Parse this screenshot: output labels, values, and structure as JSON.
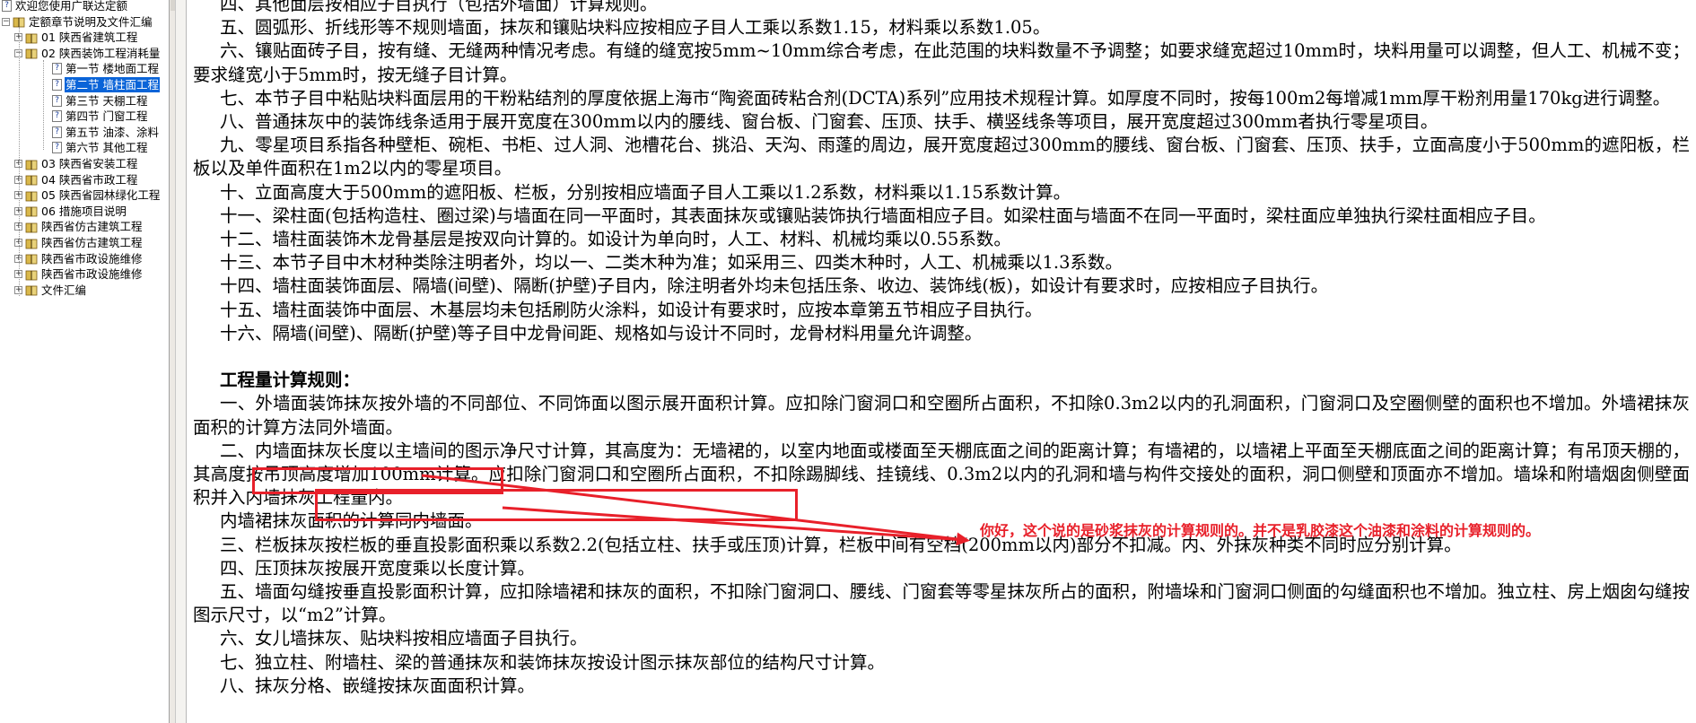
{
  "tree": {
    "items": [
      {
        "label": "欢迎您使用广联达定额",
        "icon": "page-icon",
        "level": 0,
        "expander": "none"
      },
      {
        "label": "定额章节说明及文件汇编",
        "icon": "book-icon",
        "level": 0,
        "expander": "minus"
      },
      {
        "label": "01 陕西省建筑工程",
        "icon": "book-icon",
        "level": 1,
        "expander": "plus"
      },
      {
        "label": "02 陕西装饰工程消耗量",
        "icon": "book-icon",
        "level": 1,
        "expander": "minus"
      },
      {
        "label": "第一节 楼地面工程",
        "icon": "page-icon",
        "level": 2,
        "expander": "none"
      },
      {
        "label": "第二节 墙柱面工程",
        "icon": "page-icon",
        "level": 2,
        "expander": "none",
        "selected": true
      },
      {
        "label": "第三节 天棚工程",
        "icon": "page-icon",
        "level": 2,
        "expander": "none"
      },
      {
        "label": "第四节 门窗工程",
        "icon": "page-icon",
        "level": 2,
        "expander": "none"
      },
      {
        "label": "第五节 油漆、涂料",
        "icon": "page-icon",
        "level": 2,
        "expander": "none"
      },
      {
        "label": "第六节 其他工程",
        "icon": "page-icon",
        "level": 2,
        "expander": "none"
      },
      {
        "label": "03 陕西省安装工程",
        "icon": "book-icon",
        "level": 1,
        "expander": "plus"
      },
      {
        "label": "04 陕西省市政工程",
        "icon": "book-icon",
        "level": 1,
        "expander": "plus"
      },
      {
        "label": "05 陕西省园林绿化工程",
        "icon": "book-icon",
        "level": 1,
        "expander": "plus"
      },
      {
        "label": "06 措施项目说明",
        "icon": "book-icon",
        "level": 1,
        "expander": "plus"
      },
      {
        "label": "陕西省仿古建筑工程",
        "icon": "book-icon",
        "level": 1,
        "expander": "plus"
      },
      {
        "label": "陕西省仿古建筑工程",
        "icon": "book-icon",
        "level": 1,
        "expander": "plus"
      },
      {
        "label": "陕西省市政设施维修",
        "icon": "book-icon",
        "level": 1,
        "expander": "plus"
      },
      {
        "label": "陕西省市政设施维修",
        "icon": "book-icon",
        "level": 1,
        "expander": "plus"
      },
      {
        "label": "文件汇编",
        "icon": "book-icon",
        "level": 1,
        "expander": "plus"
      }
    ]
  },
  "content": [
    {
      "type": "para",
      "text": "四、其他面层按相应子目执行（包括外墙面）计算规则。"
    },
    {
      "type": "para",
      "text": "五、圆弧形、折线形等不规则墙面，抹灰和镶贴块料应按相应子目人工乘以系数1.15，材料乘以系数1.05。"
    },
    {
      "type": "para",
      "text": "六、镶贴面砖子目，按有缝、无缝两种情况考虑。有缝的缝宽按5mm~10mm综合考虑，在此范围的块料数量不予调整；如要求缝宽超过10mm时，块料用量可以调整，但人工、机械不变；要求缝宽小于5mm时，按无缝子目计算。"
    },
    {
      "type": "para",
      "text": "七、本节子目中粘贴块料面层用的干粉粘结剂的厚度依据上海市“陶瓷面砖粘合剂(DCTA)系列”应用技术规程计算。如厚度不同时，按每100m2每增减1mm厚干粉剂用量170kg进行调整。"
    },
    {
      "type": "para",
      "text": "八、普通抹灰中的装饰线条适用于展开宽度在300mm以内的腰线、窗台板、门窗套、压顶、扶手、横竖线条等项目，展开宽度超过300mm者执行零星项目。"
    },
    {
      "type": "para",
      "text": "九、零星项目系指各种壁柜、碗柜、书柜、过人洞、池槽花台、挑沿、天沟、雨蓬的周边，展开宽度超过300mm的腰线、窗台板、门窗套、压顶、扶手，立面高度小于500mm的遮阳板，栏板以及单件面积在1m2以内的零星项目。"
    },
    {
      "type": "para",
      "text": "十、立面高度大于500mm的遮阳板、栏板，分别按相应墙面子目人工乘以1.2系数，材料乘以1.15系数计算。"
    },
    {
      "type": "para",
      "text": "十一、梁柱面(包括构造柱、圈过梁)与墙面在同一平面时，其表面抹灰或镶贴装饰执行墙面相应子目。如梁柱面与墙面不在同一平面时，梁柱面应单独执行梁柱面相应子目。"
    },
    {
      "type": "para",
      "text": "十二、墙柱面装饰木龙骨基层是按双向计算的。如设计为单向时，人工、材料、机械均乘以0.55系数。"
    },
    {
      "type": "para",
      "text": "十三、本节子目中木材种类除注明者外，均以一、二类木种为准；如采用三、四类木种时，人工、机械乘以1.3系数。"
    },
    {
      "type": "para",
      "text": "十四、墙柱面装饰面层、隔墙(间壁)、隔断(护壁)子目内，除注明者外均未包括压条、收边、装饰线(板)，如设计有要求时，应按相应子目执行。"
    },
    {
      "type": "para",
      "text": "十五、墙柱面装饰中面层、木基层均未包括刷防火涂料，如设计有要求时，应按本章第五节相应子目执行。"
    },
    {
      "type": "para",
      "text": "十六、隔墙(间壁)、隔断(护壁)等子目中龙骨间距、规格如与设计不同时，龙骨材料用量允许调整。"
    },
    {
      "type": "blank",
      "text": ""
    },
    {
      "type": "heading",
      "text": "工程量计算规则："
    },
    {
      "type": "para",
      "text": "一、外墙面装饰抹灰按外墙的不同部位、不同饰面以图示展开面积计算。应扣除门窗洞口和空圈所占面积，不扣除0.3m2以内的孔洞面积，门窗洞口及空圈侧壁的面积也不增加。外墙裙抹灰面积的计算方法同外墙面。"
    },
    {
      "type": "para",
      "text": "二、内墙面抹灰长度以主墙间的图示净尺寸计算，其高度为：无墙裙的，以室内地面或楼面至天棚底面之间的距离计算；有墙裙的，以墙裙上平面至天棚底面之间的距离计算；有吊顶天棚的，其高度按吊顶高度增加100mm计算。应扣除门窗洞口和空圈所占面积，不扣除踢脚线、挂镜线、0.3m2以内的孔洞和墙与构件交接处的面积，洞口侧壁和顶面亦不增加。墙垛和附墙烟囱侧壁面积并入内墙抹灰工程量内。"
    },
    {
      "type": "para",
      "text": "内墙裙抹灰面积的计算同内墙面。"
    },
    {
      "type": "para",
      "text": "三、栏板抹灰按栏板的垂直投影面积乘以系数2.2(包括立柱、扶手或压顶)计算，栏板中间有空档(200mm以内)部分不扣减。内、外抹灰种类不同时应分别计算。"
    },
    {
      "type": "para",
      "text": "四、压顶抹灰按展开宽度乘以长度计算。"
    },
    {
      "type": "para",
      "text": "五、墙面勾缝按垂直投影面积计算，应扣除墙裙和抹灰的面积，不扣除门窗洞口、腰线、门窗套等零星抹灰所占的面积，附墙垛和门窗洞口侧面的勾缝面积也不增加。独立柱、房上烟囱勾缝按图示尺寸，以“m2”计算。"
    },
    {
      "type": "para",
      "text": "六、女儿墙抹灰、贴块料按相应墙面子目执行。"
    },
    {
      "type": "para",
      "text": "七、独立柱、附墙柱、梁的普通抹灰和装饰抹灰按设计图示抹灰部位的结构尺寸计算。"
    },
    {
      "type": "para",
      "text": "八、抹灰分格、嵌缝按抹灰面面积计算。"
    }
  ],
  "annotation": {
    "text": "你好，这个说的是砂浆抹灰的计算规则的。并不是乳胶漆这个油漆和涂料的计算规则的。",
    "color": "#e8202a"
  }
}
